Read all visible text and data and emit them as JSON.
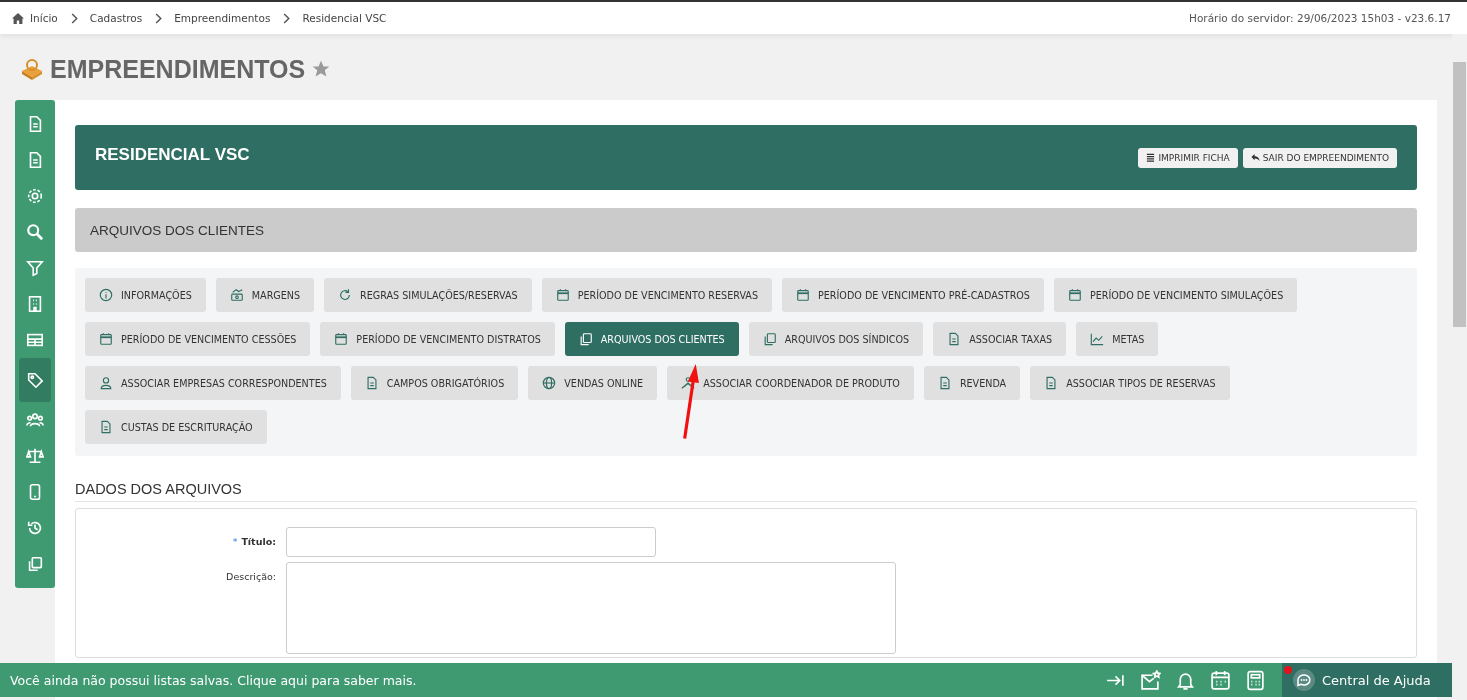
{
  "breadcrumb": [
    "Início",
    "Cadastros",
    "Empreendimentos",
    "Residencial VSC"
  ],
  "server_info": "Horário do servidor: 29/06/2023 15h03 - v23.6.17",
  "page_title": "EMPREENDIMENTOS",
  "favorite": false,
  "sidebar": {
    "items": [
      {
        "selected": false
      },
      {
        "selected": false
      },
      {
        "selected": false
      },
      {
        "selected": false
      },
      {
        "selected": false
      },
      {
        "selected": false
      },
      {
        "selected": false
      },
      {
        "selected": true
      },
      {
        "selected": false
      },
      {
        "selected": false
      },
      {
        "selected": false
      },
      {
        "selected": false
      },
      {
        "selected": false
      }
    ]
  },
  "header": {
    "title": "RESIDENCIAL VSC",
    "buttons": [
      "IMPRIMIR FICHA",
      "SAIR DO EMPREENDIMENTO"
    ]
  },
  "section_title": "ARQUIVOS DOS CLIENTES",
  "tabs": [
    {
      "label": "INFORMAÇÕES",
      "selected": false
    },
    {
      "label": "MARGENS",
      "selected": false
    },
    {
      "label": "REGRAS SIMULAÇÕES/RESERVAS",
      "selected": false
    },
    {
      "label": "PERÍODO DE VENCIMENTO RESERVAS",
      "selected": false
    },
    {
      "label": "PERÍODO DE VENCIMENTO PRÉ-CADASTROS",
      "selected": false
    },
    {
      "label": "PERÍODO DE VENCIMENTO SIMULAÇÕES",
      "selected": false
    },
    {
      "label": "PERÍODO DE VENCIMENTO CESSÕES",
      "selected": false
    },
    {
      "label": "PERÍODO DE VENCIMENTO DISTRATOS",
      "selected": false
    },
    {
      "label": "ARQUIVOS DOS CLIENTES",
      "selected": true
    },
    {
      "label": "ARQUIVOS DOS SÍNDICOS",
      "selected": false
    },
    {
      "label": "ASSOCIAR TAXAS",
      "selected": false
    },
    {
      "label": "METAS",
      "selected": false
    },
    {
      "label": "ASSOCIAR EMPRESAS CORRESPONDENTES",
      "selected": false
    },
    {
      "label": "CAMPOS OBRIGATÓRIOS",
      "selected": false
    },
    {
      "label": "VENDAS ONLINE",
      "selected": false
    },
    {
      "label": "ASSOCIAR COORDENADOR DE PRODUTO",
      "selected": false
    },
    {
      "label": "REVENDA",
      "selected": false
    },
    {
      "label": "ASSOCIAR TIPOS DE RESERVAS",
      "selected": false
    },
    {
      "label": "CUSTAS DE ESCRITURAÇÃO",
      "selected": false
    }
  ],
  "form": {
    "title": "DADOS DOS ARQUIVOS",
    "fields": [
      {
        "label": "Título:",
        "required": true,
        "mark": "*",
        "kind": "text"
      },
      {
        "label": "Descrição:",
        "required": false,
        "kind": "textarea"
      }
    ]
  },
  "bottom_bar": {
    "message": "Você ainda não possui listas salvas. Clique aqui para saber mais.",
    "help": "Central de Ajuda"
  }
}
